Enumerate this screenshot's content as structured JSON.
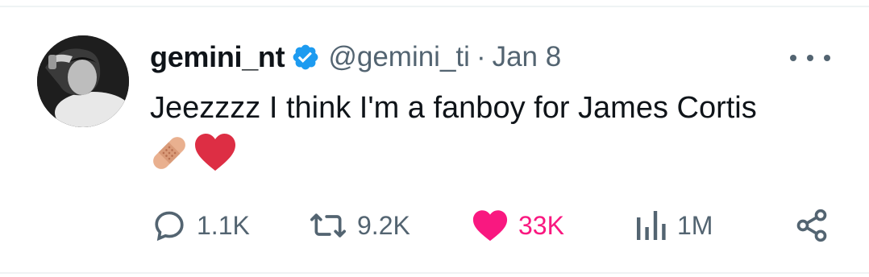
{
  "tweet": {
    "author": {
      "display_name": "gemini_nt",
      "handle": "@gemini_ti",
      "verified": true
    },
    "separator": "·",
    "date": "Jan 8",
    "text": "Jeezzzz I think I'm a fanboy for James Cortis",
    "emojis": [
      "adhesive-bandage-emoji",
      "red-heart-emoji"
    ]
  },
  "actions": {
    "reply_count": "1.1K",
    "retweet_count": "9.2K",
    "like_count": "33K",
    "view_count": "1M"
  },
  "colors": {
    "verified_blue": "#1d9bf0",
    "like_pink": "#f91880",
    "muted": "#536471",
    "text": "#0f1419"
  }
}
